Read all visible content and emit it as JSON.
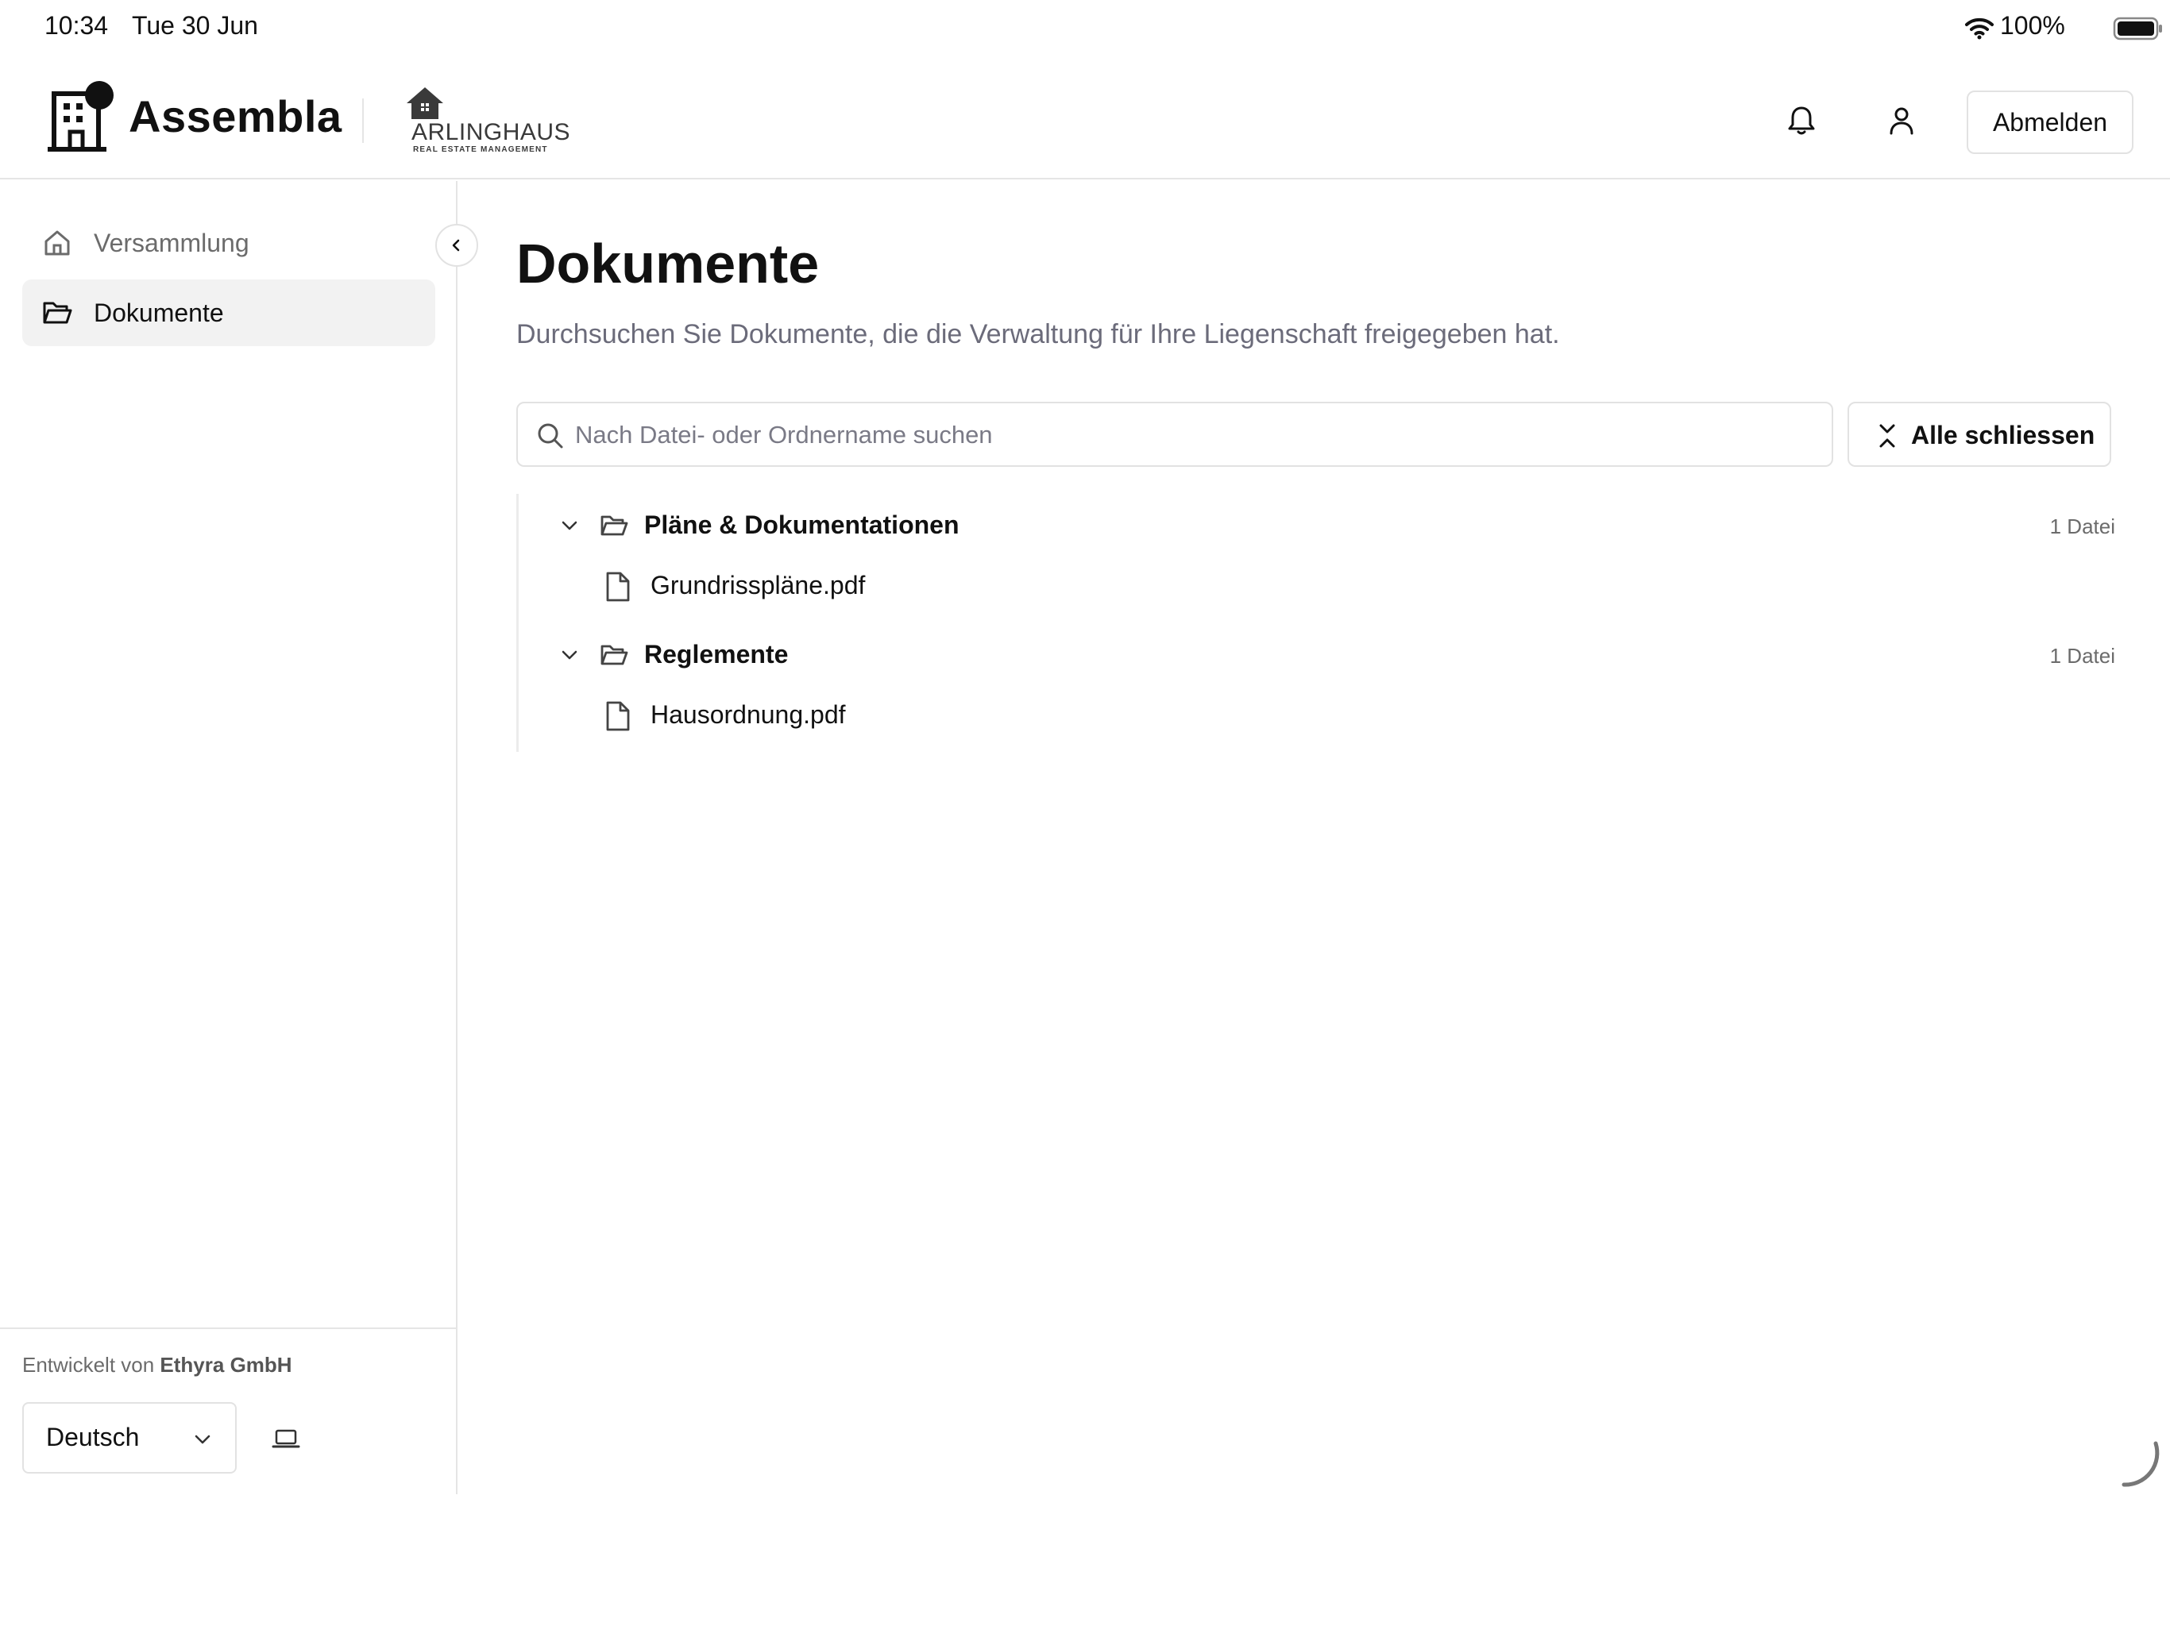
{
  "status_bar": {
    "time": "10:34",
    "date": "Tue 30 Jun",
    "battery": "100%",
    "icons": [
      "wifi-icon",
      "battery-icon"
    ]
  },
  "header": {
    "app_name": "Assembla",
    "partner_name": "ARLINGHAUS",
    "partner_subtitle": "REAL ESTATE MANAGEMENT",
    "logout_label": "Abmelden",
    "icons": [
      "building-logo-icon",
      "house-logo-icon",
      "bell-icon",
      "user-icon"
    ]
  },
  "sidebar": {
    "items": [
      {
        "label": "Versammlung",
        "icon": "home-icon",
        "active": false
      },
      {
        "label": "Dokumente",
        "icon": "folder-open-icon",
        "active": true
      }
    ],
    "credit_prefix": "Entwickelt von",
    "credit_company": "Ethyra GmbH",
    "language": "Deutsch"
  },
  "main": {
    "title": "Dokumente",
    "subtitle": "Durchsuchen Sie Dokumente, die die Verwaltung für Ihre Liegenschaft freigegeben hat.",
    "search_placeholder": "Nach Datei- oder Ordnername suchen",
    "search_value": "",
    "collapse_all_label": "Alle schliessen",
    "folders": [
      {
        "name": "Pläne & Dokumentationen",
        "count": "1 Datei",
        "files": [
          "Grundrisspläne.pdf"
        ]
      },
      {
        "name": "Reglemente",
        "count": "1 Datei",
        "files": [
          "Hausordnung.pdf"
        ]
      }
    ]
  },
  "colors": {
    "text": "#111111",
    "muted": "#6b6b7a",
    "border": "#e2e2e2",
    "active_nav_bg": "#f2f2f2"
  }
}
